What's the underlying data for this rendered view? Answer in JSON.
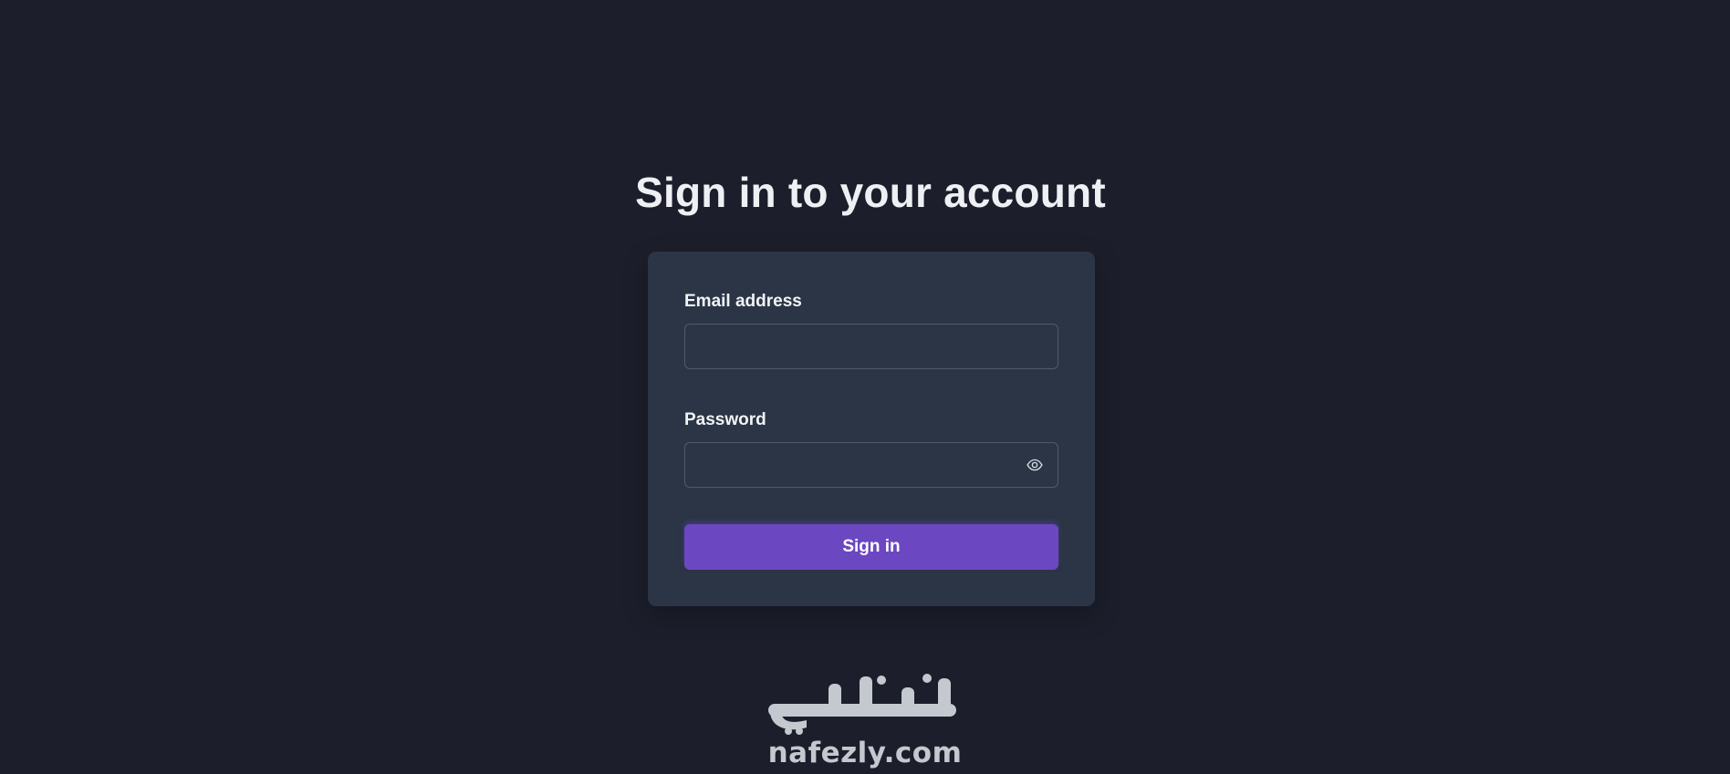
{
  "page": {
    "title": "Sign in to your account"
  },
  "form": {
    "email_label": "Email address",
    "email_value": "",
    "password_label": "Password",
    "password_value": "",
    "submit_label": "Sign in"
  },
  "icons": {
    "password_toggle": "eye-icon"
  },
  "brand": {
    "logo_text": "نفذلي",
    "url": "nafezly.com"
  },
  "colors": {
    "background": "#1c1f2b",
    "card": "#2b3546",
    "accent": "#6c47c2"
  }
}
